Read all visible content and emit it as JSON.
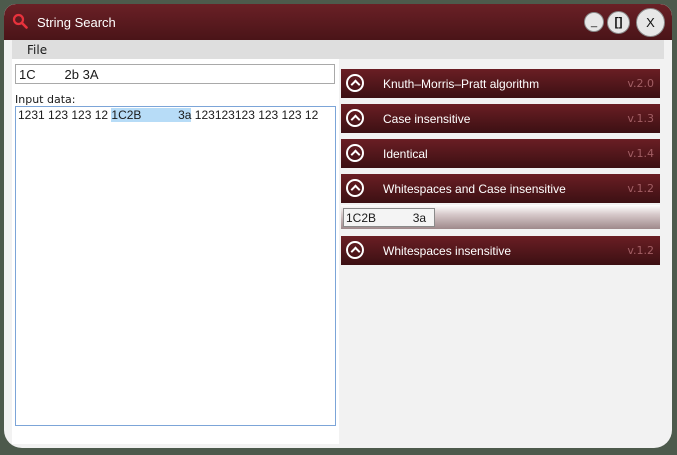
{
  "window": {
    "title": "String Search"
  },
  "controls": {
    "minimize": "_",
    "maximize": "[]",
    "close": "X"
  },
  "menu": {
    "file": "File"
  },
  "search": {
    "value": "1C        2b 3A"
  },
  "input": {
    "label": "Input data:",
    "before": "1231 123 123 12 ",
    "match": "1C2B           3a",
    "after": " 123123123 123 123 12"
  },
  "algorithms": [
    {
      "title": "Knuth–Morris–Pratt algorithm",
      "version": "v.2.0"
    },
    {
      "title": "Case insensitive",
      "version": "v.1.3"
    },
    {
      "title": "Identical",
      "version": "v.1.4"
    },
    {
      "title": "Whitespaces and Case insensitive",
      "version": "v.1.2",
      "expanded": true,
      "result": "1C2B           3a"
    },
    {
      "title": "Whitespaces insensitive",
      "version": "v.1.2"
    }
  ],
  "colors": {
    "accent": "#5a1a1f",
    "highlight": "#b7dcf7",
    "border": "#7ca5d8"
  },
  "icons": {
    "app": "search-icon",
    "accordion": "chevron-up-circle-icon"
  }
}
